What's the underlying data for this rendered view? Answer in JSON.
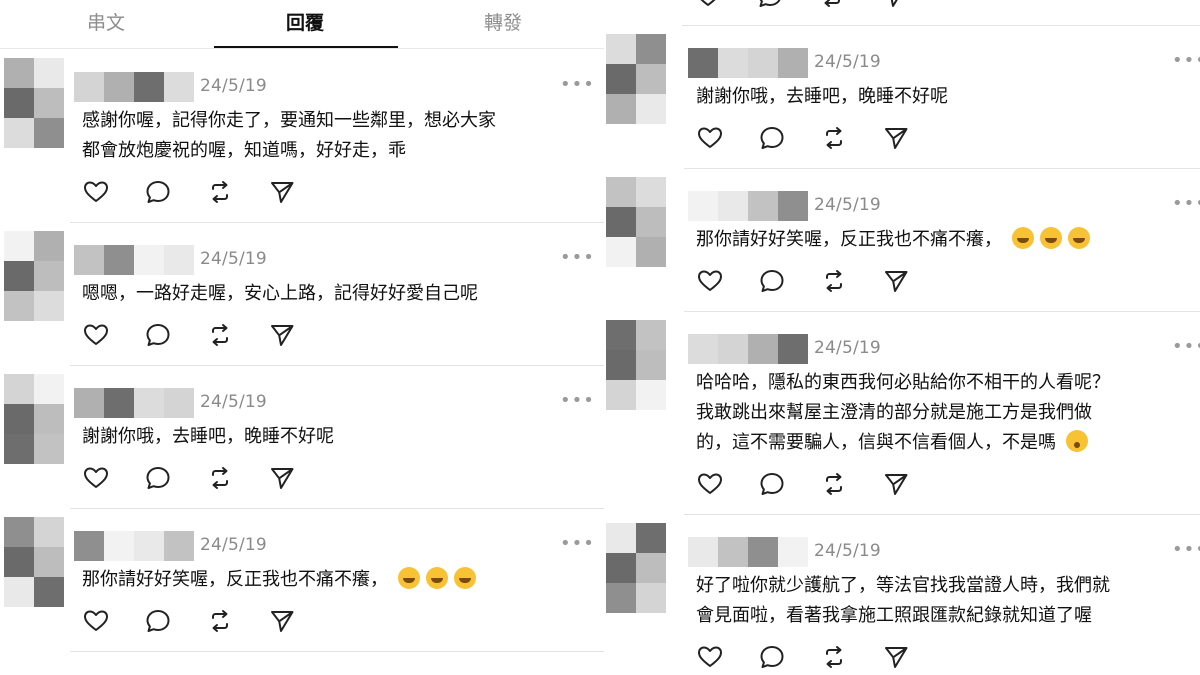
{
  "tabs": [
    "串文",
    "回覆",
    "轉發"
  ],
  "active_tab_index": 1,
  "more_glyph": "•••",
  "left_replies": [
    {
      "date": "24/5/19",
      "lines": [
        "感謝你喔，記得你走了，要通知一些鄰里，想必大家",
        "都會放炮慶祝的喔，知道嗎，好好走，乖"
      ],
      "emojis": 0
    },
    {
      "date": "24/5/19",
      "lines": [
        "嗯嗯，一路好走喔，安心上路，記得好好愛自己呢"
      ],
      "emojis": 0
    },
    {
      "date": "24/5/19",
      "lines": [
        "謝謝你哦，去睡吧，晚睡不好呢"
      ],
      "emojis": 0
    },
    {
      "date": "24/5/19",
      "lines": [
        "那你請好好笑喔，反正我也不痛不癢，"
      ],
      "emojis": 3
    }
  ],
  "right_replies": [
    {
      "date": "24/5/19",
      "lines": [
        "謝謝你哦，去睡吧，晚睡不好呢"
      ],
      "emojis": 0
    },
    {
      "date": "24/5/19",
      "lines": [
        "那你請好好笑喔，反正我也不痛不癢，"
      ],
      "emojis": 3
    },
    {
      "date": "24/5/19",
      "lines": [
        "哈哈哈，隱私的東西我何必貼給你不相干的人看呢？",
        "我敢跳出來幫屋主澄清的部分就是施工方是我們做",
        "的，這不需要騙人，信與不信看個人，不是嗎"
      ],
      "emojis": 1
    },
    {
      "date": "24/5/19",
      "lines": [
        "好了啦你就少護航了，等法官找我當證人時，我們就",
        "會見面啦，看著我拿施工照跟匯款紀錄就知道了喔"
      ],
      "emojis": 0
    }
  ],
  "icons": [
    "heart-icon",
    "comment-icon",
    "repost-icon",
    "share-icon"
  ],
  "colors": {
    "text": "#111111",
    "muted": "#8a8a8a",
    "divider": "#e3e3e3",
    "emoji": "#f7c234"
  }
}
